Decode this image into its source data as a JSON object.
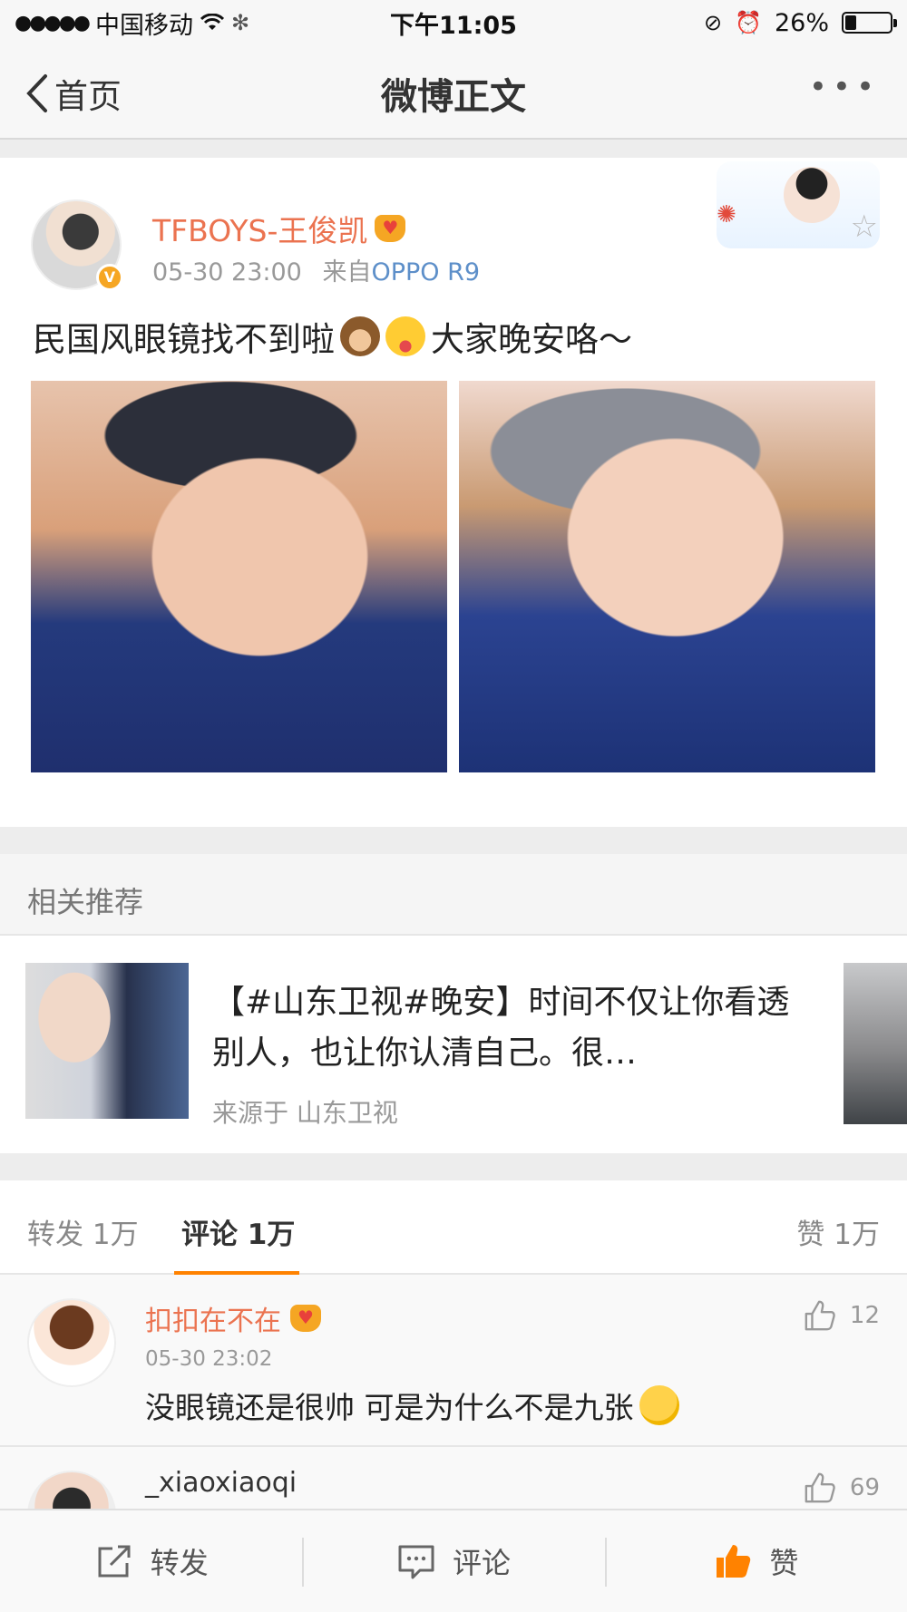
{
  "status_bar": {
    "signal": "●●●●●",
    "carrier": "中国移动",
    "time": "下午11:05",
    "battery": "26%",
    "battery_level": 0.26
  },
  "nav": {
    "back_label": "首页",
    "title": "微博正文",
    "more_label": "•••"
  },
  "post": {
    "username": "TFBOYS-王俊凯",
    "timestamp": "05-30 23:00",
    "source_prefix": "来自",
    "source": "OPPO R9",
    "text_part1": "民国风眼镜找不到啦",
    "text_part2": "大家晚安咯～"
  },
  "related": {
    "header": "相关推荐",
    "title": "【#山东卫视#晚安】时间不仅让你看透别人，也让你认清自己。很…",
    "source": "来源于 山东卫视"
  },
  "tabs": {
    "repost": "转发 1万",
    "comment": "评论 1万",
    "like": "赞 1万"
  },
  "comments": [
    {
      "name": "扣扣在不在",
      "time": "05-30 23:02",
      "text": "没眼镜还是很帅 可是为什么不是九张",
      "likes": "12"
    },
    {
      "name": "_xiaoxiaoqi",
      "likes": "69"
    }
  ],
  "toolbar": {
    "repost": "转发",
    "comment": "评论",
    "like": "赞"
  },
  "colors": {
    "accent_orange": "#ff8200",
    "username_orange": "#eb7350",
    "link_blue": "#5d8fc9"
  }
}
